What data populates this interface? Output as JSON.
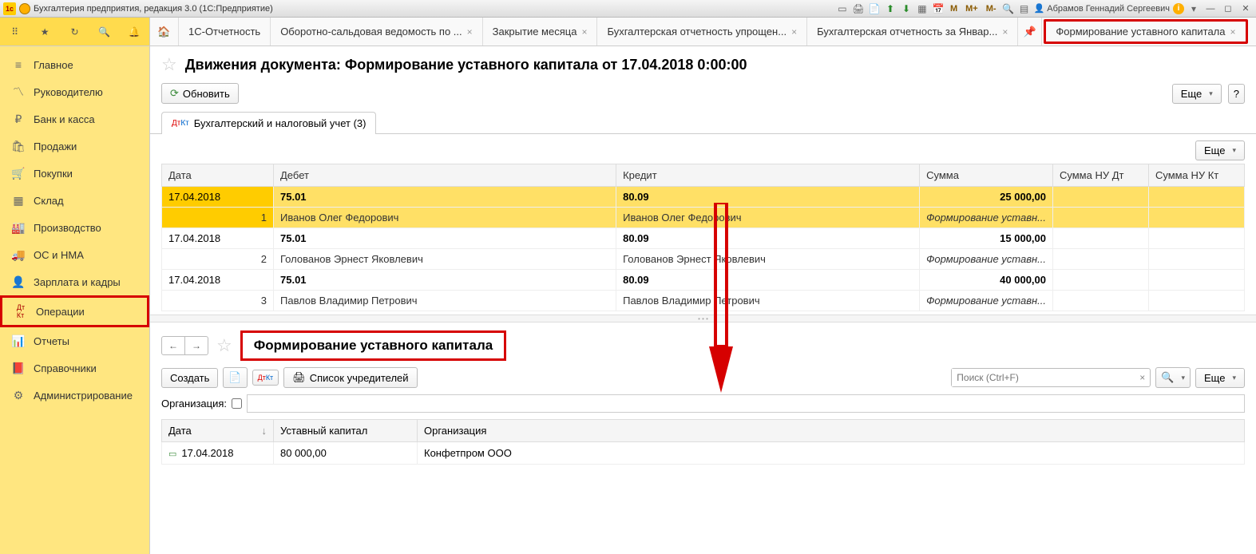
{
  "titlebar": {
    "app_title": "Бухгалтерия предприятия, редакция 3.0  (1С:Предприятие)",
    "user_name": "Абрамов Геннадий Сергеевич",
    "m_buttons": [
      "M",
      "M+",
      "M-"
    ]
  },
  "tabs": {
    "items": [
      {
        "label": "1С-Отчетность",
        "closable": false
      },
      {
        "label": "Оборотно-сальдовая ведомость по ...",
        "closable": true
      },
      {
        "label": "Закрытие месяца",
        "closable": true
      },
      {
        "label": "Бухгалтерская отчетность упрощен...",
        "closable": true
      },
      {
        "label": "Бухгалтерская отчетность за Январ...",
        "closable": true
      }
    ],
    "active": {
      "label": "Формирование уставного капитала",
      "closable": true
    }
  },
  "sidebar": {
    "items": [
      {
        "icon": "≡",
        "label": "Главное"
      },
      {
        "icon": "📈",
        "label": "Руководителю"
      },
      {
        "icon": "₽",
        "label": "Банк и касса"
      },
      {
        "icon": "🛍",
        "label": "Продажи"
      },
      {
        "icon": "🛒",
        "label": "Покупки"
      },
      {
        "icon": "▦",
        "label": "Склад"
      },
      {
        "icon": "🏭",
        "label": "Производство"
      },
      {
        "icon": "🚚",
        "label": "ОС и НМА"
      },
      {
        "icon": "👤",
        "label": "Зарплата и кадры"
      },
      {
        "icon": "ДтКт",
        "label": "Операции",
        "active": true
      },
      {
        "icon": "📊",
        "label": "Отчеты"
      },
      {
        "icon": "📕",
        "label": "Справочники"
      },
      {
        "icon": "⚙",
        "label": "Администрирование"
      }
    ]
  },
  "doc": {
    "title": "Движения документа: Формирование уставного капитала от 17.04.2018 0:00:00",
    "refresh": "Обновить",
    "more": "Еще",
    "help": "?",
    "tab_label": "Бухгалтерский и налоговый учет (3)"
  },
  "grid": {
    "headers": {
      "date": "Дата",
      "debit": "Дебет",
      "credit": "Кредит",
      "sum": "Сумма",
      "sum_nu_dt": "Сумма НУ Дт",
      "sum_nu_kt": "Сумма НУ Кт"
    },
    "rows": [
      {
        "n": "1",
        "date": "17.04.2018",
        "debit_acc": "75.01",
        "debit_name": "Иванов Олег Федорович",
        "credit_acc": "80.09",
        "credit_name": "Иванов Олег Федорович",
        "sum": "25 000,00",
        "desc": "Формирование уставн...",
        "selected": true
      },
      {
        "n": "2",
        "date": "17.04.2018",
        "debit_acc": "75.01",
        "debit_name": "Голованов Эрнест Яковлевич",
        "credit_acc": "80.09",
        "credit_name": "Голованов Эрнест Яковлевич",
        "sum": "15 000,00",
        "desc": "Формирование уставн..."
      },
      {
        "n": "3",
        "date": "17.04.2018",
        "debit_acc": "75.01",
        "debit_name": "Павлов Владимир Петрович",
        "credit_acc": "80.09",
        "credit_name": "Павлов Владимир Петрович",
        "sum": "40 000,00",
        "desc": "Формирование уставн..."
      }
    ]
  },
  "lower": {
    "title": "Формирование уставного капитала",
    "create": "Создать",
    "founders": "Список учредителей",
    "search_placeholder": "Поиск (Ctrl+F)",
    "more": "Еще",
    "org_label": "Организация:",
    "headers": {
      "date": "Дата",
      "capital": "Уставный капитал",
      "org": "Организация"
    },
    "row": {
      "date": "17.04.2018",
      "capital": "80 000,00",
      "org": "Конфетпром ООО"
    }
  }
}
